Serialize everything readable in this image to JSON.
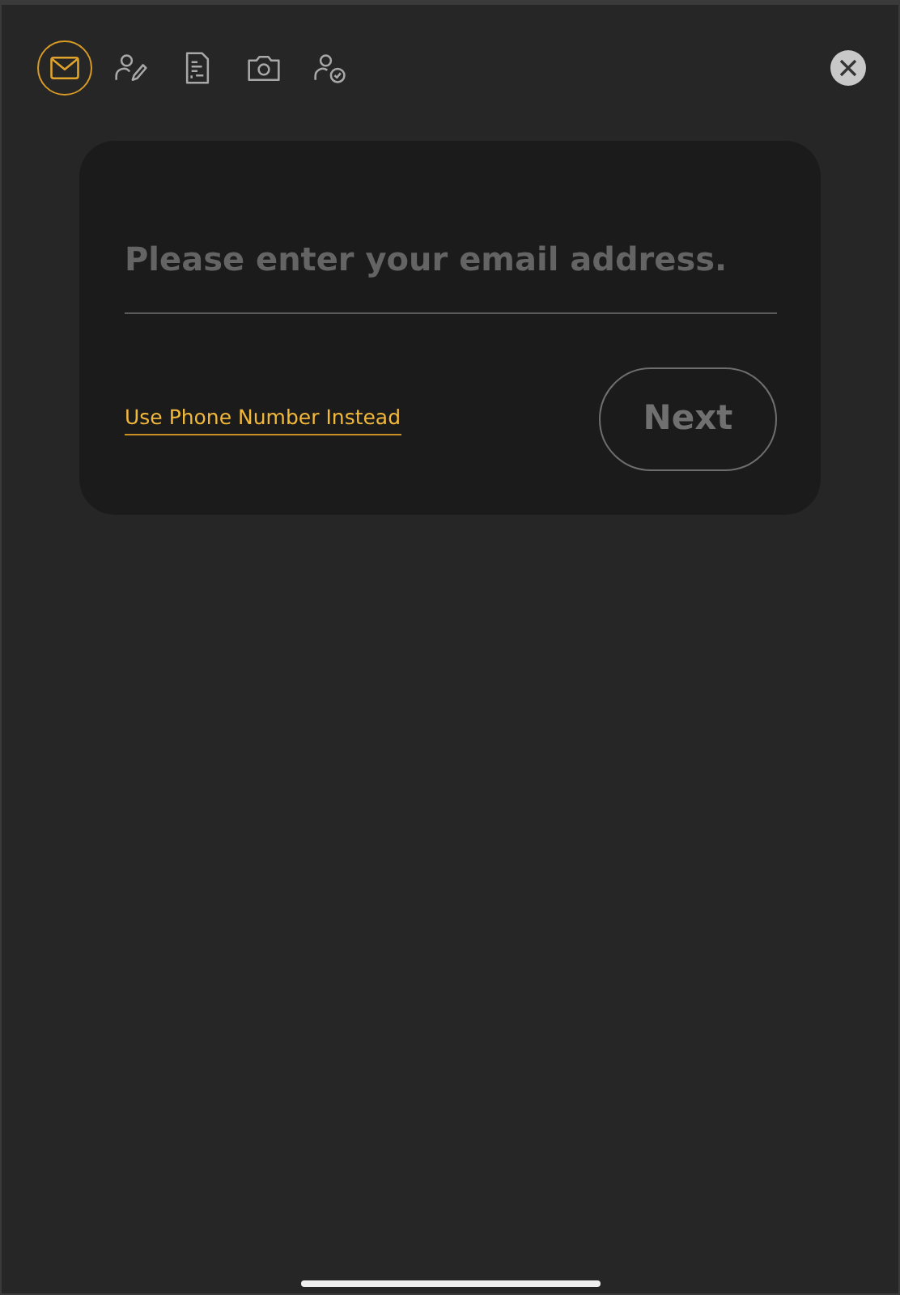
{
  "steps": [
    {
      "kind": "email",
      "selected": true
    },
    {
      "kind": "profile-edit",
      "selected": false
    },
    {
      "kind": "document",
      "selected": false
    },
    {
      "kind": "camera",
      "selected": false
    },
    {
      "kind": "profile-check",
      "selected": false
    }
  ],
  "form": {
    "email_field": {
      "placeholder": "Please enter your email address."
    },
    "alt_link": "Use Phone Number Instead",
    "next_button": {
      "label": "Next",
      "disabled": true
    }
  }
}
